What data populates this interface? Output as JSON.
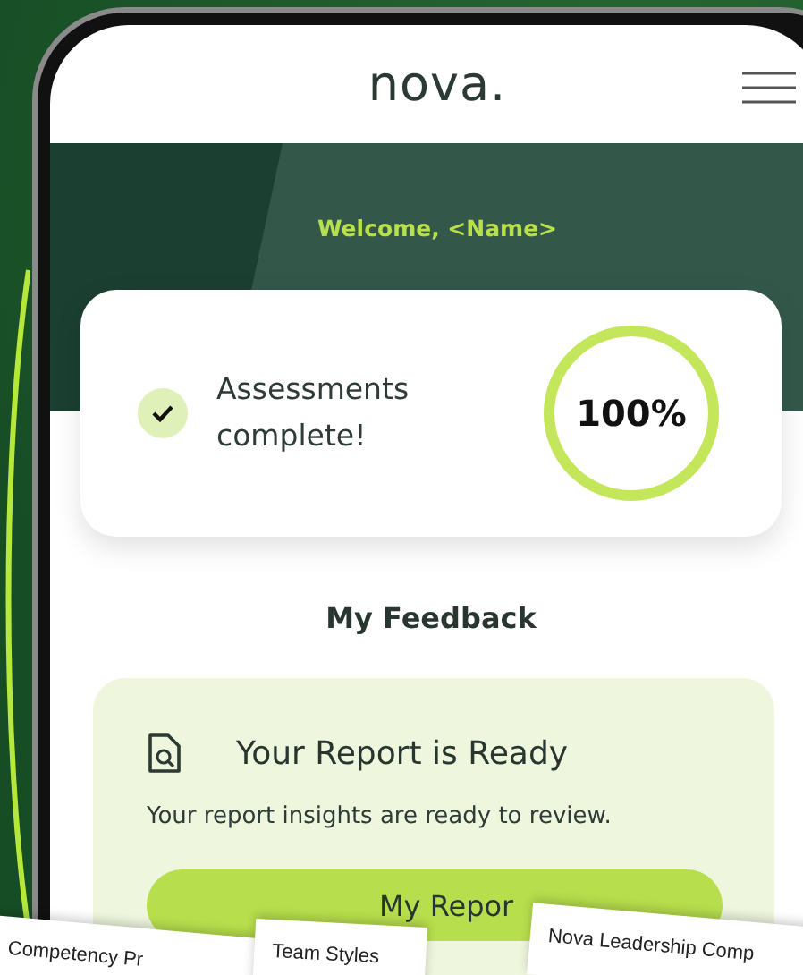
{
  "header": {
    "logo": "nova."
  },
  "welcome": "Welcome, <Name>",
  "assessment": {
    "checked": true,
    "label": "Assessments complete!",
    "level": 1,
    "reading": "100%"
  },
  "feedback_title": "My Feedback",
  "report": {
    "title": "Your Report is Ready",
    "text": "Your report insights are ready to review.",
    "button": "My Repor"
  },
  "documents": [
    {
      "title": "Competency Pr"
    },
    {
      "title": "Team Styles"
    },
    {
      "title": "Nova Leadership Comp"
    }
  ]
}
